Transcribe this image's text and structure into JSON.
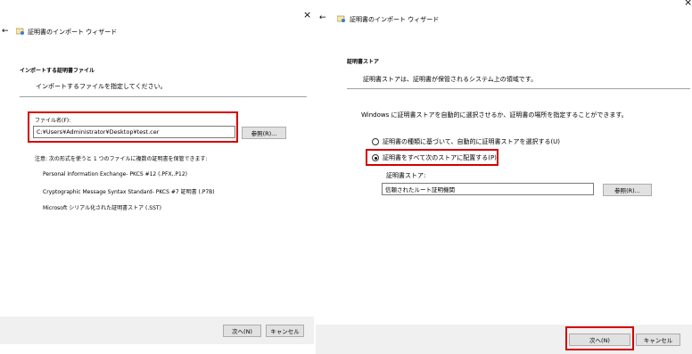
{
  "left": {
    "close_glyph": "×",
    "back_glyph": "←",
    "title": "証明書のインポート ウィザード",
    "section_heading": "インポートする証明書ファイル",
    "section_desc": "インポートするファイルを指定してください。",
    "file_label": "ファイル名(F):",
    "file_value": "C:¥Users¥Administrator¥Desktop¥test.cer",
    "browse_label": "参照(R)...",
    "note": "注意: 次の形式を使うと 1 つのファイルに複数の証明書を保管できます:",
    "formats": [
      "Personal Information Exchange- PKCS #12 (.PFX,.P12)",
      "Cryptographic Message Syntax Standard- PKCS #7 証明書 (.P7B)",
      "Microsoft シリアル化された証明書ストア (.SST)"
    ],
    "next_label": "次へ(N)",
    "cancel_label": "キャンセル"
  },
  "right": {
    "close_glyph": "×",
    "back_glyph": "←",
    "title": "証明書のインポート ウィザード",
    "section_heading": "証明書ストア",
    "section_desc": "証明書ストアは、証明書が保管されるシステム上の領域です。",
    "info_text": "Windows に証明書ストアを自動的に選択させるか、証明書の場所を指定することができます。",
    "radio_auto": "証明書の種類に基づいて、自動的に証明書ストアを選択する(U)",
    "radio_manual": "証明書をすべて次のストアに配置する(P)",
    "store_label": "証明書ストア:",
    "store_value": "信頼されたルート証明機関",
    "browse_label": "参照(R)...",
    "next_label": "次へ(N)",
    "cancel_label": "キャンセル"
  },
  "colors": {
    "highlight": "#d40000",
    "footer": "#f0f0f0",
    "button": "#e1e1e1"
  }
}
